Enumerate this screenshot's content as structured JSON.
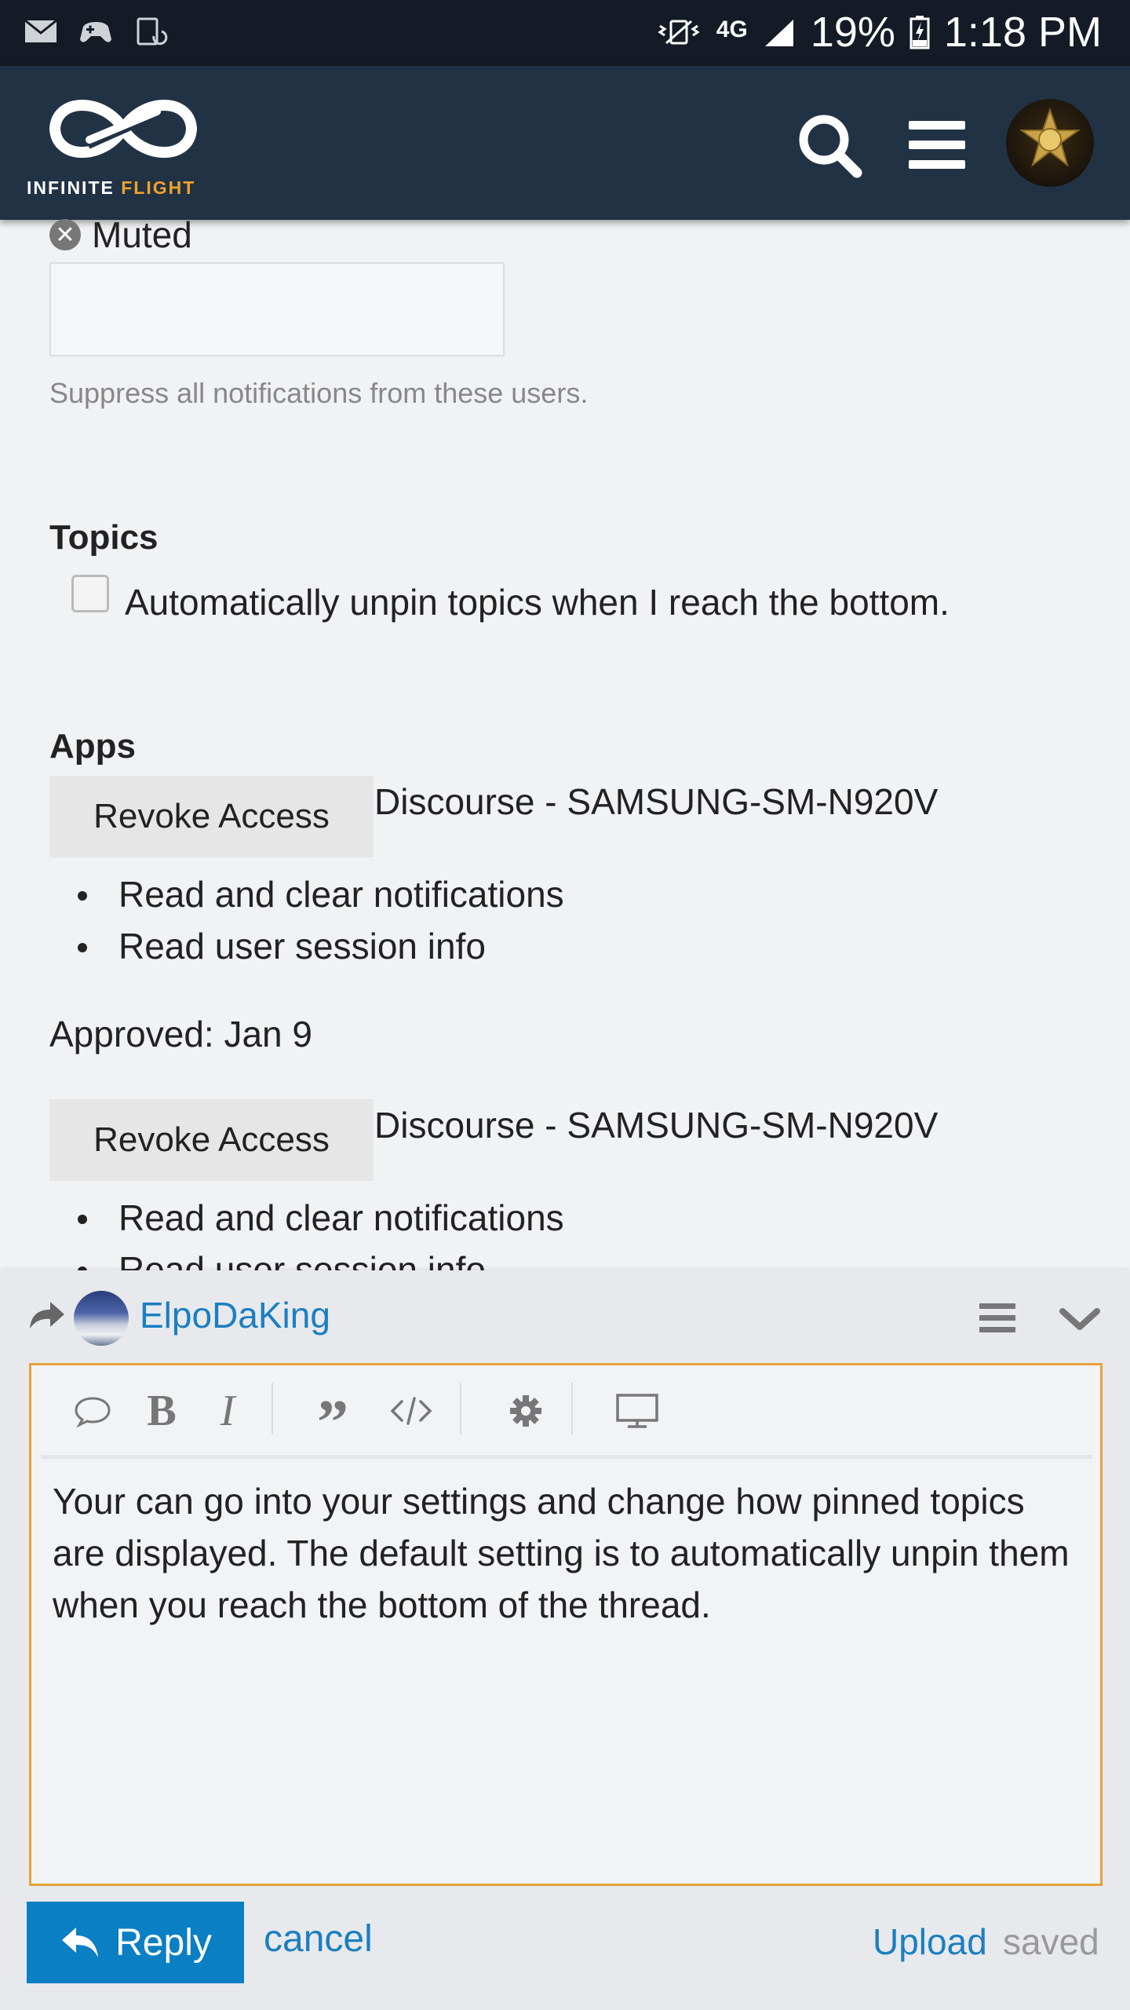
{
  "status_bar": {
    "battery": "19%",
    "time": "1:18 PM",
    "network": "4G",
    "icons": [
      "mail-icon",
      "game-controller-icon",
      "screen-rotate-icon",
      "vibrate-icon",
      "signal-icon",
      "battery-charging-icon"
    ]
  },
  "header": {
    "logo_word_white": "INFINITE",
    "logo_word_accent": "FLIGHT",
    "icons": [
      "search-icon",
      "hamburger-menu-icon",
      "user-avatar-badge"
    ],
    "accent_color": "#f0a329",
    "background": "#213245"
  },
  "muted": {
    "label": "Muted",
    "help": "Suppress all notifications from these users."
  },
  "topics": {
    "heading": "Topics",
    "checkbox_label": "Automatically unpin topics when I reach the bottom.",
    "checked": false
  },
  "apps": {
    "heading": "Apps",
    "items": [
      {
        "button": "Revoke Access",
        "name": "Discourse - SAMSUNG-SM-N920V",
        "permissions": [
          "Read and clear notifications",
          "Read user session info"
        ],
        "approved": "Approved: Jan 9"
      },
      {
        "button": "Revoke Access",
        "name": "Discourse - SAMSUNG-SM-N920V",
        "permissions": [
          "Read and clear notifications",
          "Read user session info"
        ]
      }
    ]
  },
  "composer": {
    "username": "ElpoDaKing",
    "toolbar_icons": [
      "speech-bubble-icon",
      "bold-icon",
      "italic-icon",
      "quote-icon",
      "code-icon",
      "gear-icon",
      "preview-screen-icon"
    ],
    "text": "Your can go into your settings and change how pinned topics are displayed. The default setting is to automatically unpin them when you reach the bottom of the thread.",
    "reply_label": "Reply",
    "cancel_label": "cancel",
    "upload_label": "Upload",
    "saved_label": "saved",
    "accent_color": "#0a7fc4",
    "editor_border_color": "#e4a43b"
  }
}
